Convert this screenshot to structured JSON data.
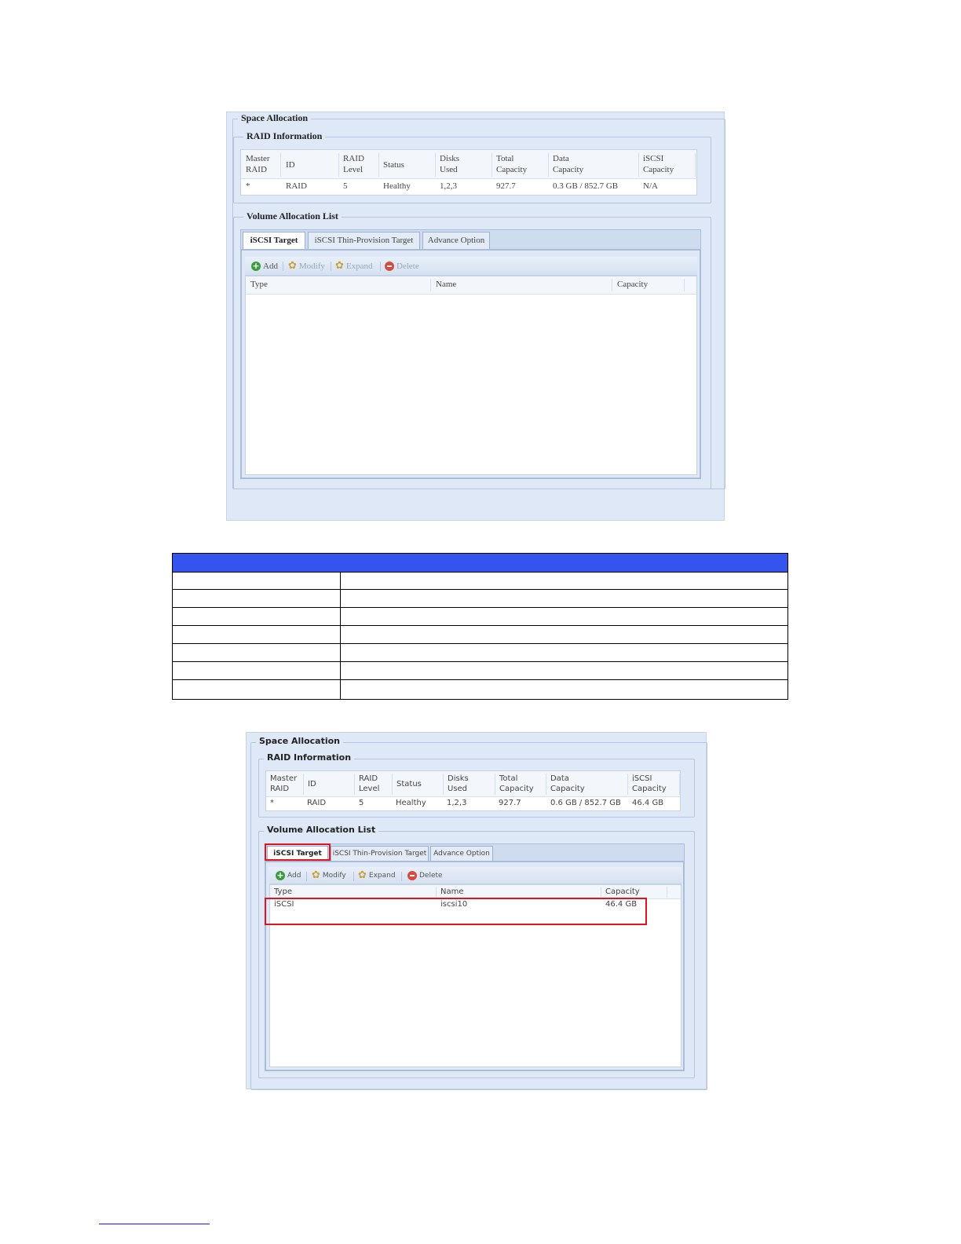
{
  "panel1": {
    "space_allocation_legend": "Space Allocation",
    "raid_information_legend": "RAID Information",
    "raid_columns": [
      {
        "line1": "Master",
        "line2": "RAID"
      },
      {
        "line1": "ID",
        "line2": ""
      },
      {
        "line1": "RAID",
        "line2": "Level"
      },
      {
        "line1": "Status",
        "line2": ""
      },
      {
        "line1": "Disks",
        "line2": "Used"
      },
      {
        "line1": "Total",
        "line2": "Capacity"
      },
      {
        "line1": "Data",
        "line2": "Capacity"
      },
      {
        "line1": "iSCSI",
        "line2": "Capacity"
      }
    ],
    "raid_row": [
      "*",
      "RAID",
      "5",
      "Healthy",
      "1,2,3",
      "927.7",
      "0.3 GB / 852.7 GB",
      "N/A"
    ],
    "volume_allocation_legend": "Volume Allocation List",
    "tabs": [
      "iSCSI Target",
      "iSCSI Thin-Provision Target",
      "Advance Option"
    ],
    "toolbar": {
      "add": "Add",
      "modify": "Modify",
      "expand": "Expand",
      "delete": "Delete"
    },
    "list_columns": [
      "Type",
      "Name",
      "Capacity"
    ]
  },
  "panel2": {
    "space_allocation_legend": "Space Allocation",
    "raid_information_legend": "RAID Information",
    "raid_columns": [
      {
        "line1": "Master",
        "line2": "RAID"
      },
      {
        "line1": "ID",
        "line2": ""
      },
      {
        "line1": "RAID",
        "line2": "Level"
      },
      {
        "line1": "Status",
        "line2": ""
      },
      {
        "line1": "Disks",
        "line2": "Used"
      },
      {
        "line1": "Total",
        "line2": "Capacity"
      },
      {
        "line1": "Data",
        "line2": "Capacity"
      },
      {
        "line1": "iSCSI",
        "line2": "Capacity"
      }
    ],
    "raid_row": [
      "*",
      "RAID",
      "5",
      "Healthy",
      "1,2,3",
      "927.7",
      "0.6 GB / 852.7 GB",
      "46.4 GB"
    ],
    "volume_allocation_legend": "Volume Allocation List",
    "tabs": [
      "iSCSI Target",
      "iSCSI Thin-Provision Target",
      "Advance Option"
    ],
    "toolbar": {
      "add": "Add",
      "modify": "Modify",
      "expand": "Expand",
      "delete": "Delete"
    },
    "list_columns": [
      "Type",
      "Name",
      "Capacity"
    ],
    "list_row": [
      "iSCSI",
      "iscsi10",
      "46.4 GB"
    ]
  },
  "colors": {
    "panel_bg": "#dfe8f6",
    "table_header_blue": "#3355ee",
    "highlight_red": "#e0141c"
  }
}
